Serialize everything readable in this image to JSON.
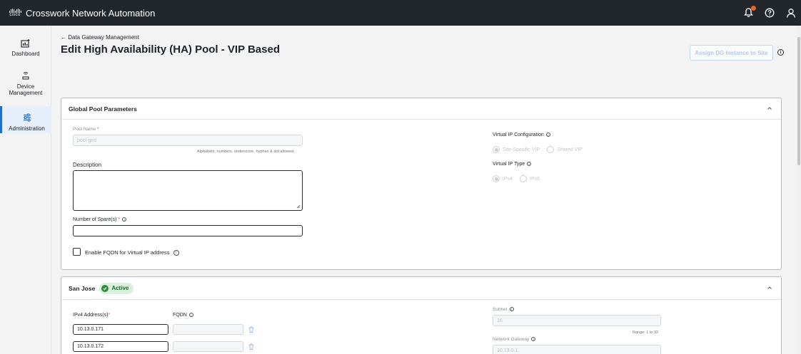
{
  "app": {
    "logo_text": "cisco",
    "title": "Crosswork Network Automation"
  },
  "sidebar": {
    "items": [
      {
        "label": "Dashboard"
      },
      {
        "label": "Device Management"
      },
      {
        "label": "Administration",
        "active": true
      }
    ]
  },
  "breadcrumb": {
    "back_label": "← Data Gateway Management"
  },
  "page": {
    "title": "Edit High Availability (HA) Pool - VIP Based",
    "assign_button": "Assign DG Instance to Site"
  },
  "global_pool": {
    "header": "Global Pool Parameters",
    "pool_name_label": "Pool Name",
    "pool_name_value": "pool-geo",
    "pool_name_hint": "Alphabets, numbers, underscore, hyphen & dot allowed.",
    "description_label": "Description",
    "description_value": "",
    "spares_label": "Number of Spare(s)",
    "spares_value": "",
    "fqdn_checkbox_label": "Enable FQDN for Virtual IP address",
    "vip_config_label": "Virtual IP Configuration",
    "vip_config_options": [
      "Site-Specific VIP",
      "Shared VIP"
    ],
    "vip_config_selected": "Site-Specific VIP",
    "vip_type_label": "Virtual IP Type",
    "vip_type_options": [
      "IPv4",
      "IPv6"
    ],
    "vip_type_selected": "IPv4"
  },
  "site": {
    "name": "San Jose",
    "status": "Active",
    "ipv4_label": "IPv4 Address(s)",
    "fqdn_label": "FQDN",
    "addresses": [
      "10.13.0.171",
      "10.13.0.172"
    ],
    "subnet_label": "Subnet",
    "subnet_value": "16",
    "subnet_hint": "Range: 1 to 32",
    "gateway_label": "Network Gateway",
    "gateway_value": "10.13.0.1"
  },
  "colors": {
    "accent": "#1b6dd9",
    "topbar": "#22272e",
    "active_badge": "#d9f0dc",
    "notification": "#e8642a"
  }
}
